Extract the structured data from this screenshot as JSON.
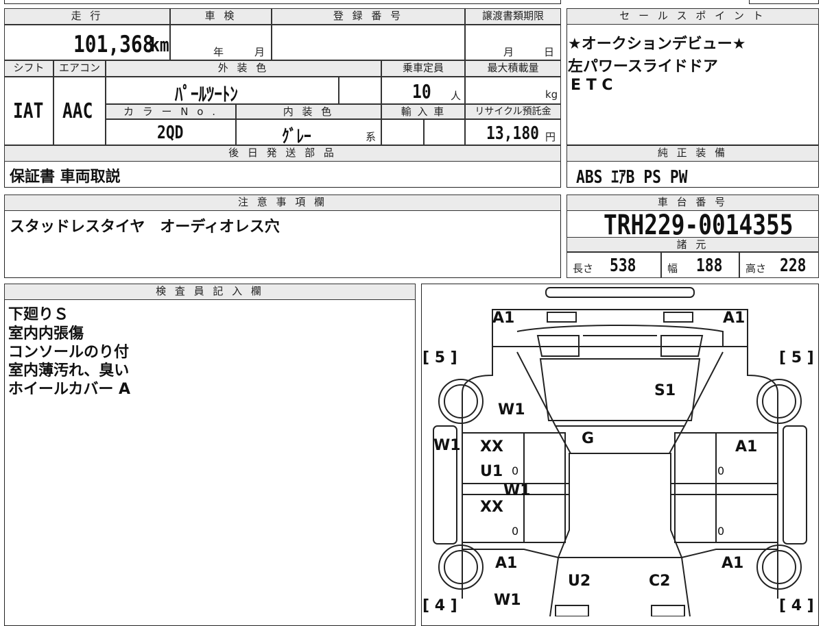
{
  "top": {
    "mileage_label": "走 行",
    "mileage_value": "101,368",
    "mileage_unit": "km",
    "inspection_label": "車 検",
    "inspection_year": "年",
    "inspection_month": "月",
    "registration_label": "登 録 番 号",
    "transfer_label": "譲渡書類期限",
    "transfer_month": "月",
    "transfer_day": "日"
  },
  "row2": {
    "shift_label": "シフト",
    "shift_value": "IAT",
    "ac_label": "エアコン",
    "ac_value": "AAC",
    "exterior_label": "外 装 色",
    "exterior_value": "ﾊﾟｰﾙﾂｰﾄﾝ",
    "capacity_label": "乗車定員",
    "capacity_value": "10",
    "capacity_unit": "人",
    "maxload_label": "最大積載量",
    "maxload_unit": "kg",
    "color_no_label": "カ ラ ー N o .",
    "color_no_value": "2QD",
    "interior_label": "内 装 色",
    "interior_value": "ｸﾞﾚｰ",
    "interior_suffix": "系",
    "import_label": "輸 入 車",
    "recycle_label": "リサイクル預託金",
    "recycle_value": "13,180",
    "recycle_unit": "円"
  },
  "later_parts": {
    "label": "後 日 発 送 部 品",
    "value": "保証書 車両取説"
  },
  "sales_points": {
    "label": "セ ー ル ス ポ イ ン ト",
    "lines": [
      "★オークションデビュー★",
      "左パワースライドドア",
      "E T C"
    ]
  },
  "genuine_equipment": {
    "label": "純 正 装 備",
    "value": "ABS ｴｱB PS PW"
  },
  "notes": {
    "label": "注 意 事 項 欄",
    "value": "スタッドレスタイヤ　オーディオレス穴"
  },
  "chassis": {
    "label": "車 台 番 号",
    "value": "TRH229-0014355"
  },
  "specs": {
    "label": "諸 元",
    "length_label": "長さ",
    "length_value": "538",
    "width_label": "幅",
    "width_value": "188",
    "height_label": "高さ",
    "height_value": "228"
  },
  "inspector": {
    "label": "検 査 員 記 入 欄",
    "lines": [
      "下廻りＳ",
      "室内内張傷",
      "コンソールのり付",
      "室内薄汚れ、臭い",
      "ホイールカバー A"
    ]
  },
  "diagram": {
    "marks": {
      "front_left": "A1",
      "front_right": "A1",
      "tire_fl": "[ 5 ]",
      "tire_fr": "[ 5 ]",
      "tire_rl": "[ 4 ]",
      "tire_rr": "[ 4 ]",
      "hood": "S1",
      "fender_left": "W1",
      "windshield": "G",
      "left_panel": "W1",
      "door_l1a": "XX",
      "door_l1b": "U1",
      "door_l_mid": "W1",
      "door_l2": "XX",
      "door_r1": "A1",
      "rear_left": "A1",
      "rear_right": "A1",
      "rear_u": "U2",
      "rear_c": "C2",
      "rear_w": "W1",
      "zero": "0"
    }
  }
}
